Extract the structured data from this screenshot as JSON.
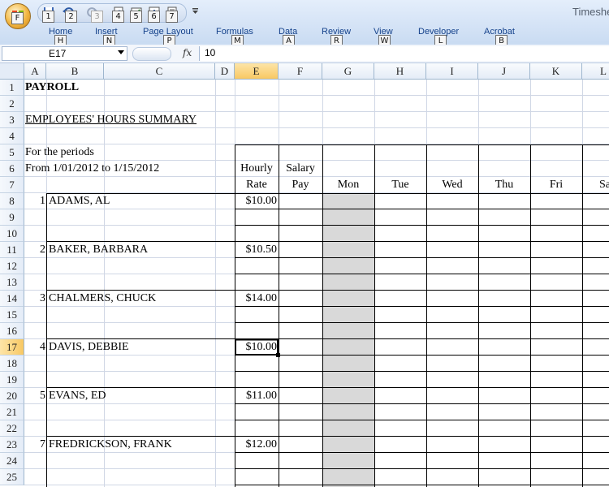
{
  "app": {
    "title": "Timeshe"
  },
  "ribbon": {
    "tabs": [
      "Home",
      "Insert",
      "Page Layout",
      "Formulas",
      "Data",
      "Review",
      "View",
      "Developer",
      "Acrobat"
    ],
    "keytips": [
      "H",
      "N",
      "P",
      "M",
      "A",
      "R",
      "W",
      "L",
      "B"
    ],
    "office_keytip": "F",
    "qat_keytips": [
      "1",
      "2",
      "3",
      "4",
      "5",
      "6",
      "7"
    ]
  },
  "formula_bar": {
    "name_box": "E17",
    "fx_label": "fx",
    "value": "10"
  },
  "grid": {
    "columns": [
      "A",
      "B",
      "C",
      "D",
      "E",
      "F",
      "G",
      "H",
      "I",
      "J",
      "K",
      "L"
    ],
    "rows": [
      "1",
      "2",
      "3",
      "4",
      "5",
      "6",
      "7",
      "8",
      "9",
      "10",
      "11",
      "12",
      "13",
      "14",
      "15",
      "16",
      "17",
      "18",
      "19",
      "20",
      "21",
      "22",
      "23",
      "24",
      "25"
    ],
    "selected_cell": "E17"
  },
  "sheet": {
    "title": "PAYROLL",
    "subtitle": "EMPLOYEES' HOURS SUMMARY",
    "period_label": "For the periods",
    "period_range": "From 1/01/2012 to 1/15/2012",
    "headers": {
      "hourly": "Hourly",
      "rate": "Rate",
      "salary": "Salary",
      "pay": "Pay",
      "days": [
        "Mon",
        "Tue",
        "Wed",
        "Thu",
        "Fri",
        "Sa"
      ]
    },
    "employees": [
      {
        "num": "1",
        "name": "ADAMS, AL",
        "rate": "$10.00"
      },
      {
        "num": "2",
        "name": "BAKER, BARBARA",
        "rate": "$10.50"
      },
      {
        "num": "3",
        "name": "CHALMERS, CHUCK",
        "rate": "$14.00"
      },
      {
        "num": "4",
        "name": "DAVIS, DEBBIE",
        "rate": "$10.00"
      },
      {
        "num": "5",
        "name": "EVANS, ED",
        "rate": "$11.00"
      },
      {
        "num": "7",
        "name": "FREDRICKSON, FRANK",
        "rate": "$12.00"
      }
    ]
  },
  "colors": {
    "gray_column": "#d9d9d9",
    "gridline": "#d0d7e5",
    "selection_header": "#f8c863"
  },
  "icons": {
    "office_button": "office-logo-icon",
    "save": "save-icon",
    "undo": "undo-icon",
    "redo": "redo-icon",
    "customize": "qat-customize-icon"
  }
}
